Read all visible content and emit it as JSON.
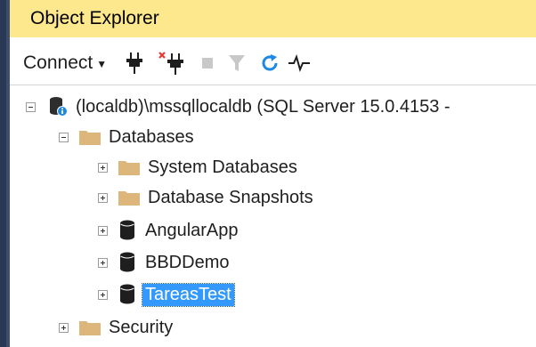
{
  "panel": {
    "title": "Object Explorer"
  },
  "toolbar": {
    "connect_label": "Connect",
    "connect_dropdown_icon": "chevron-down-icon",
    "buttons": [
      {
        "name": "connect-object-explorer-button",
        "icon": "plug-icon"
      },
      {
        "name": "disconnect-button",
        "icon": "unplug-icon"
      },
      {
        "name": "stop-button",
        "icon": "stop-icon"
      },
      {
        "name": "filter-button",
        "icon": "filter-icon"
      },
      {
        "name": "refresh-button",
        "icon": "refresh-icon"
      },
      {
        "name": "activity-monitor-button",
        "icon": "activity-icon"
      }
    ],
    "colors": {
      "refresh": "#1e88e5",
      "disconnect_x": "#e53935",
      "disabled": "#c8c8c8"
    }
  },
  "tree": {
    "server": "(localdb)\\mssqllocaldb (SQL Server 15.0.4153 -",
    "databases": "Databases",
    "system_databases": "System Databases",
    "database_snapshots": "Database Snapshots",
    "db_angularapp": "AngularApp",
    "db_bbdddemo": "BBDDemo",
    "db_tareastest": "TareasTest",
    "security": "Security",
    "selected": "TareasTest"
  },
  "colors": {
    "title_bar": "#fde88e",
    "selection": "#3399ff",
    "folder": "#dcb67a",
    "left_strip": "#293955"
  }
}
